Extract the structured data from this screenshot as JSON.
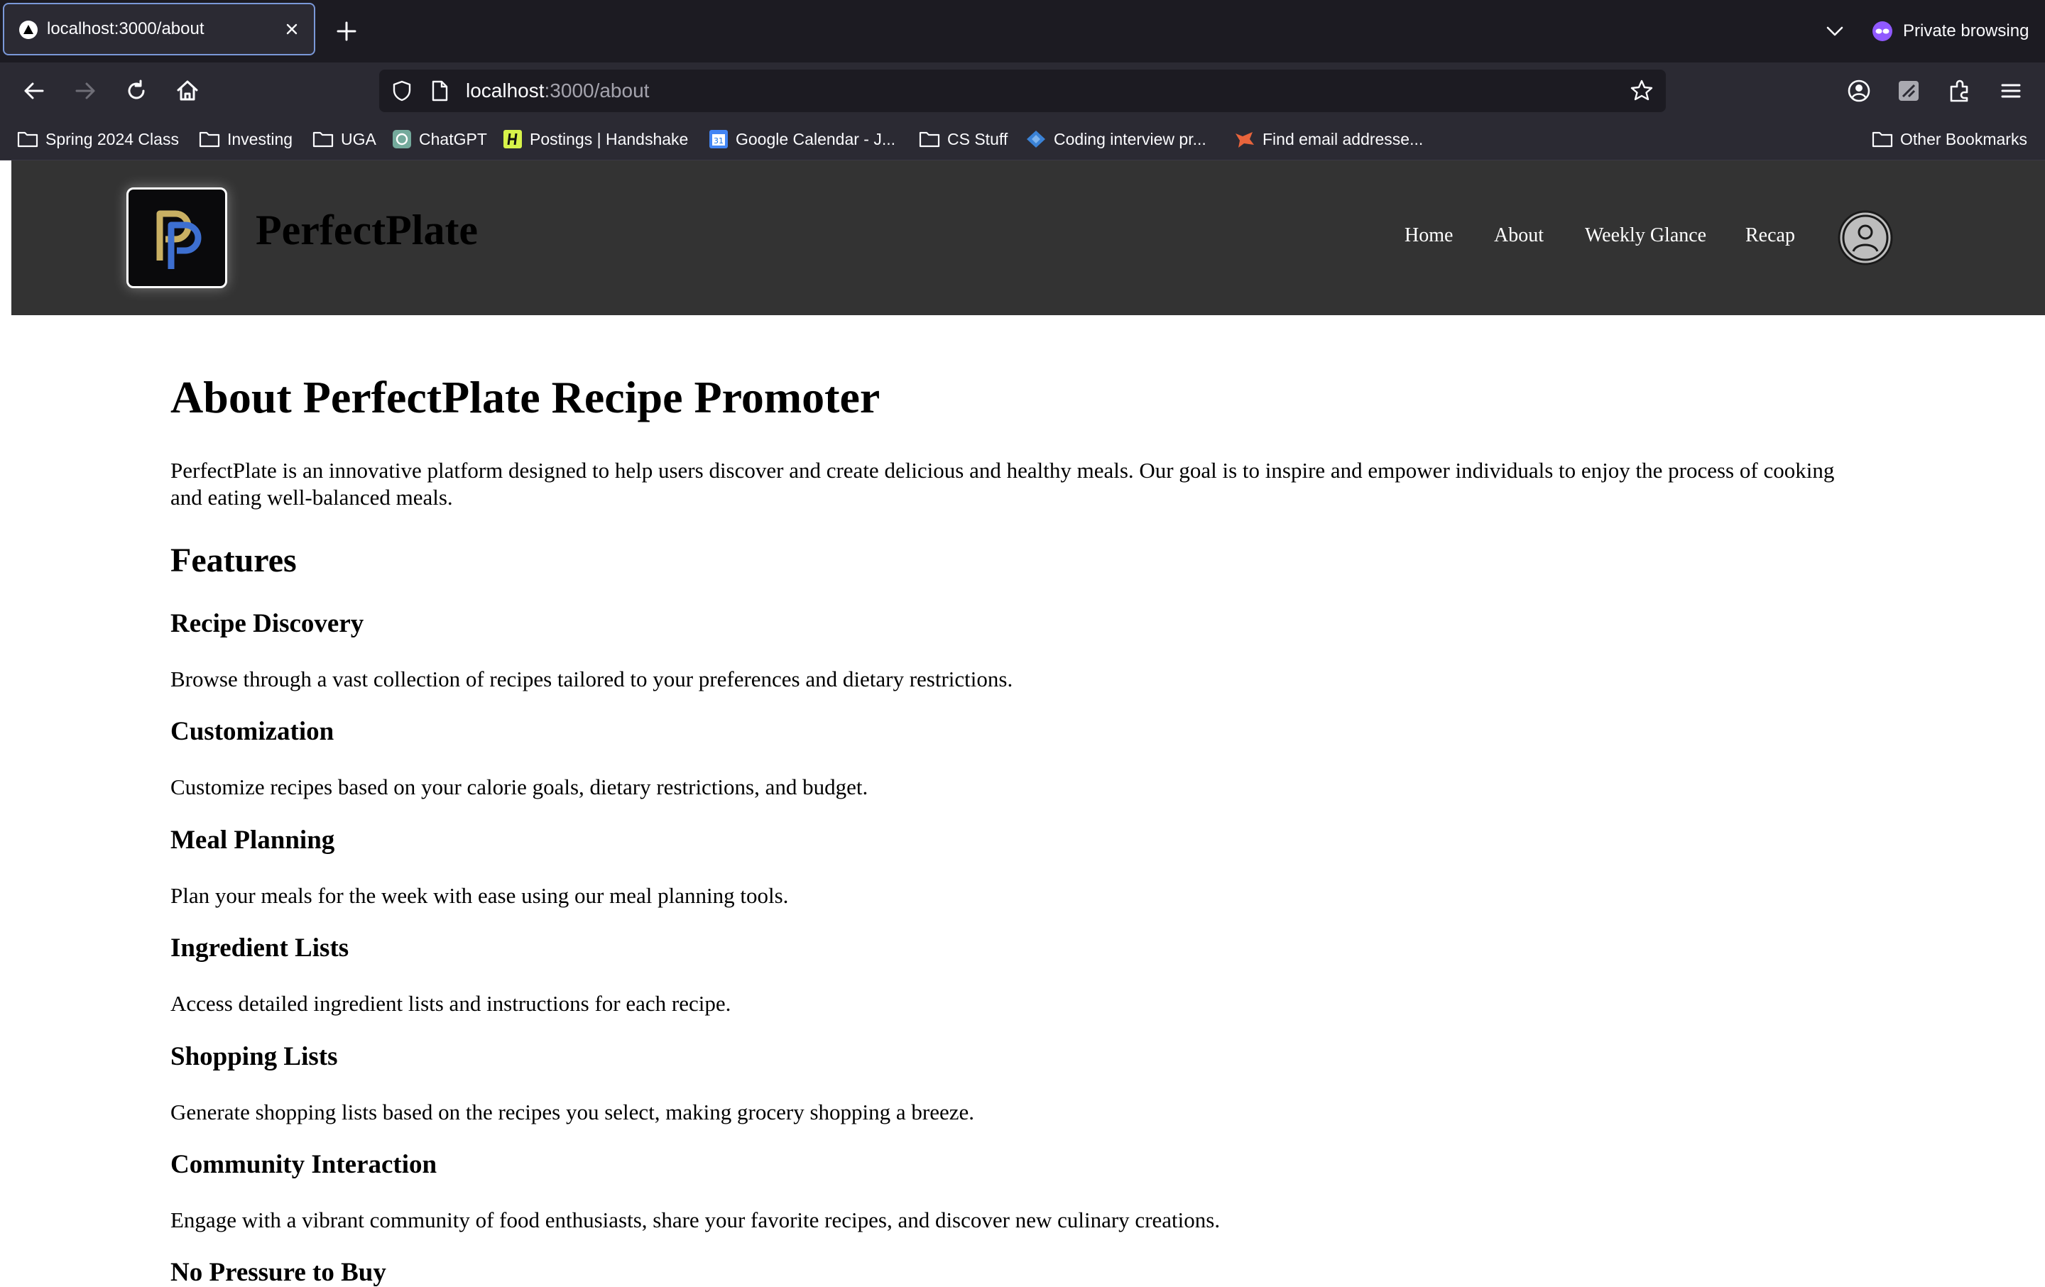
{
  "browser": {
    "tab": {
      "title": "localhost:3000/about"
    },
    "private_label": "Private browsing",
    "url": {
      "host": "localhost",
      "path": ":3000/about"
    },
    "bookmarks": [
      {
        "label": "Spring 2024 Class",
        "icon": "folder-icon"
      },
      {
        "label": "Investing",
        "icon": "folder-icon"
      },
      {
        "label": "UGA",
        "icon": "folder-icon"
      },
      {
        "label": "ChatGPT",
        "icon": "chatgpt-icon"
      },
      {
        "label": "Postings | Handshake",
        "icon": "handshake-icon"
      },
      {
        "label": "Google Calendar - J...",
        "icon": "calendar-icon"
      },
      {
        "label": "CS Stuff",
        "icon": "folder-icon"
      },
      {
        "label": "Coding interview pr...",
        "icon": "diamond-icon"
      },
      {
        "label": "Find email addresse...",
        "icon": "fox-icon"
      }
    ],
    "other_bookmarks": "Other Bookmarks"
  },
  "site": {
    "brand": "PerfectPlate",
    "nav": [
      "Home",
      "About",
      "Weekly Glance",
      "Recap"
    ]
  },
  "page": {
    "title": "About PerfectPlate Recipe Promoter",
    "intro": "PerfectPlate is an innovative platform designed to help users discover and create delicious and healthy meals. Our goal is to inspire and empower individuals to enjoy the process of cooking and eating well-balanced meals.",
    "features_heading": "Features",
    "features": [
      {
        "title": "Recipe Discovery",
        "text": "Browse through a vast collection of recipes tailored to your preferences and dietary restrictions."
      },
      {
        "title": "Customization",
        "text": "Customize recipes based on your calorie goals, dietary restrictions, and budget."
      },
      {
        "title": "Meal Planning",
        "text": "Plan your meals for the week with ease using our meal planning tools."
      },
      {
        "title": "Ingredient Lists",
        "text": "Access detailed ingredient lists and instructions for each recipe."
      },
      {
        "title": "Shopping Lists",
        "text": "Generate shopping lists based on the recipes you select, making grocery shopping a breeze."
      },
      {
        "title": "Community Interaction",
        "text": "Engage with a vibrant community of food enthusiasts, share your favorite recipes, and discover new culinary creations."
      },
      {
        "title": "No Pressure to Buy",
        "text": ""
      }
    ]
  },
  "colors": {
    "chrome_dark": "#1c1b22",
    "chrome": "#2b2a33",
    "site_header": "#333333",
    "logo_gold": "#c9b063",
    "logo_blue": "#3d6fd0"
  }
}
